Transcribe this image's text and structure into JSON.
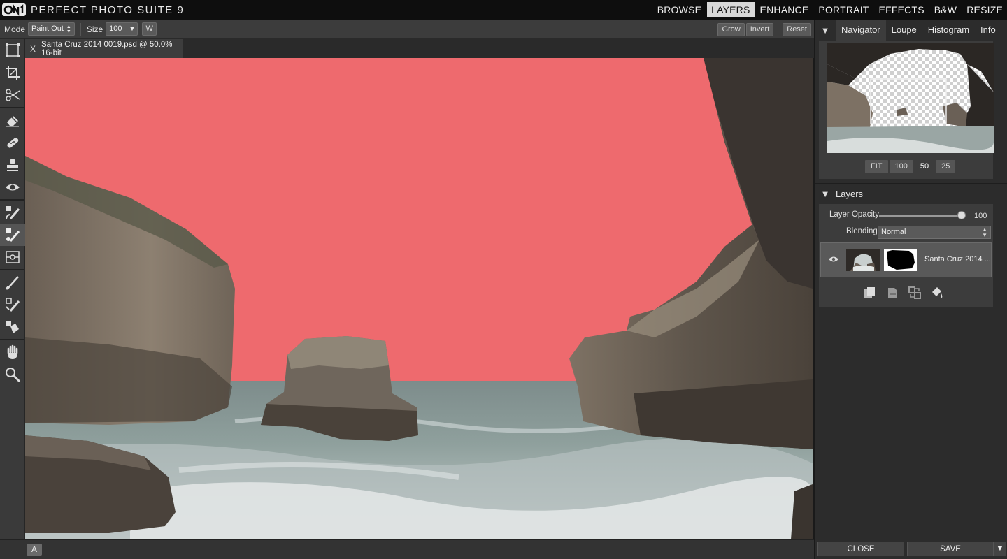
{
  "app": {
    "title": "PERFECT PHOTO SUITE 9",
    "modules": [
      {
        "label": "BROWSE",
        "active": false
      },
      {
        "label": "LAYERS",
        "active": true
      },
      {
        "label": "ENHANCE",
        "active": false
      },
      {
        "label": "PORTRAIT",
        "active": false
      },
      {
        "label": "EFFECTS",
        "active": false
      },
      {
        "label": "B&W",
        "active": false
      },
      {
        "label": "RESIZE",
        "active": false
      }
    ]
  },
  "options": {
    "mode_label": "Mode",
    "mode_value": "Paint Out",
    "size_label": "Size",
    "size_value": "100",
    "w_button": "W",
    "grow": "Grow",
    "invert": "Invert",
    "reset": "Reset"
  },
  "document": {
    "close": "X",
    "tab_title": "Santa Cruz 2014 0019.psd @ 50.0% 16-bit"
  },
  "status": {
    "a_button": "A"
  },
  "panel": {
    "tabs": [
      "Navigator",
      "Loupe",
      "Histogram",
      "Info"
    ],
    "active_tab": "Navigator",
    "zoom": [
      "FIT",
      "100",
      "50",
      "25"
    ],
    "active_zoom": "50",
    "layers_title": "Layers",
    "opacity_label": "Layer Opacity",
    "opacity_value": "100",
    "blending_label": "Blending",
    "blending_value": "Normal",
    "layer_name": "Santa Cruz 2014 ...",
    "close": "CLOSE",
    "save": "SAVE"
  },
  "colors": {
    "mask_overlay": "#ee6a6e",
    "active_module_bg": "#d8d8d8"
  }
}
